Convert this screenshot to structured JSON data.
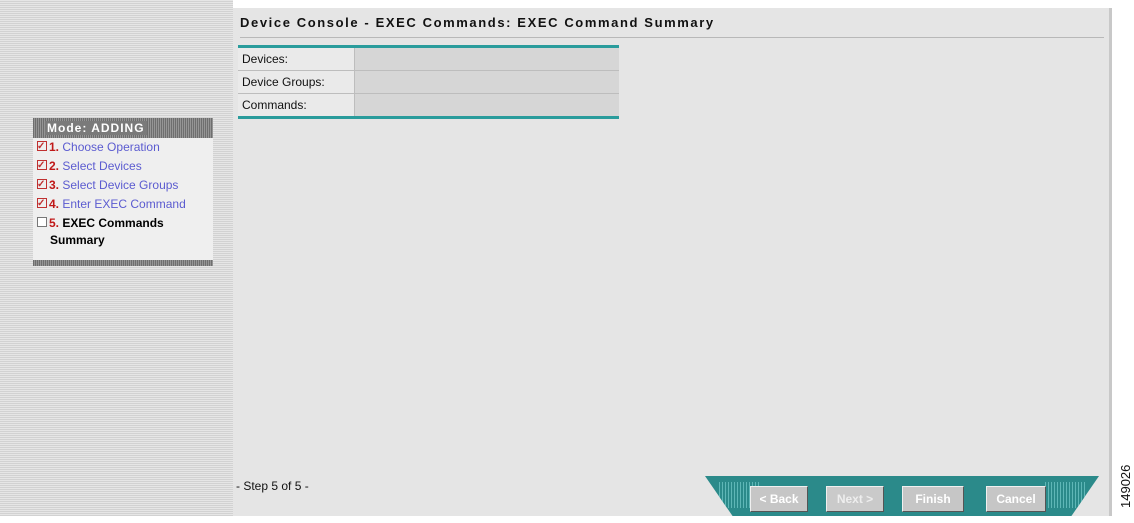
{
  "header": {
    "title": "Device Console - EXEC Commands: EXEC Command Summary"
  },
  "summary": {
    "rows": [
      {
        "label": "Devices:",
        "value": ""
      },
      {
        "label": "Device Groups:",
        "value": ""
      },
      {
        "label": "Commands:",
        "value": ""
      }
    ]
  },
  "wizard": {
    "mode": "Mode: ADDING",
    "steps": [
      {
        "num": "1.",
        "label": "Choose Operation",
        "done": true
      },
      {
        "num": "2.",
        "label": "Select Devices",
        "done": true
      },
      {
        "num": "3.",
        "label": "Select Device Groups",
        "done": true
      },
      {
        "num": "4.",
        "label": "Enter EXEC Command",
        "done": true
      },
      {
        "num": "5.",
        "label_line1": "EXEC Commands",
        "label_line2": "Summary",
        "done": false
      }
    ],
    "step_counter": "- Step 5 of 5 -"
  },
  "buttons": {
    "back": "< Back",
    "next": "Next >",
    "finish": "Finish",
    "cancel": "Cancel"
  },
  "figure_id": "149026",
  "colors": {
    "accent": "#2b8a8a",
    "link": "#5b5bd0",
    "step_number": "#c01818"
  }
}
